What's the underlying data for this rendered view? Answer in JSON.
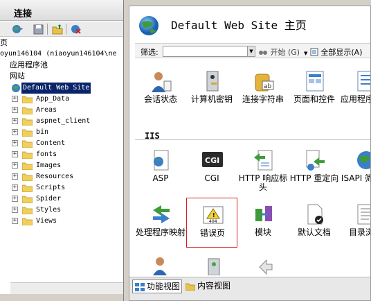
{
  "connections": {
    "title": "连接",
    "tree": [
      {
        "label": "页",
        "indent": 0
      },
      {
        "label": "oyun146104 (niaoyun146104\\ne",
        "indent": 0,
        "mono": true
      },
      {
        "label": "应用程序池",
        "indent": 0
      },
      {
        "label": "网站",
        "indent": 0
      },
      {
        "label": "Default Web Site",
        "selected": true
      },
      {
        "label": "App_Data"
      },
      {
        "label": "Areas"
      },
      {
        "label": "aspnet_client"
      },
      {
        "label": "bin"
      },
      {
        "label": "Content"
      },
      {
        "label": "fonts"
      },
      {
        "label": "Images"
      },
      {
        "label": "Resources"
      },
      {
        "label": "Scripts"
      },
      {
        "label": "Spider"
      },
      {
        "label": "Styles"
      },
      {
        "label": "Views"
      }
    ]
  },
  "home": {
    "title": "Default Web Site 主页",
    "filter": {
      "label": "筛选:",
      "start": "开始 (G)",
      "show_all": "全部显示(A)"
    },
    "group_iis": "IIS",
    "features_top": [
      {
        "name": "session-state",
        "label": "会话状态"
      },
      {
        "name": "machine-key",
        "label": "计算机密钥"
      },
      {
        "name": "connection-strings",
        "label": "连接字符串"
      },
      {
        "name": "pages-controls",
        "label": "页面和控件"
      },
      {
        "name": "app-settings",
        "label": "应用程序设置"
      }
    ],
    "features_iis_row1": [
      {
        "name": "asp",
        "label": "ASP"
      },
      {
        "name": "cgi",
        "label": "CGI"
      },
      {
        "name": "http-response-headers",
        "label": "HTTP 响应标头"
      },
      {
        "name": "http-redirect",
        "label": "HTTP 重定向"
      },
      {
        "name": "isapi-filters",
        "label": "ISAPI 筛选器"
      }
    ],
    "features_iis_row2": [
      {
        "name": "handler-mappings",
        "label": "处理程序映射"
      },
      {
        "name": "error-pages",
        "label": "错误页"
      },
      {
        "name": "modules",
        "label": "模块"
      },
      {
        "name": "default-document",
        "label": "默认文档"
      },
      {
        "name": "directory-browsing",
        "label": "目录浏览"
      }
    ],
    "tabs": {
      "features_view": "功能视图",
      "content_view": "内容视图"
    }
  },
  "colors": {
    "selection": "#0a246a",
    "highlight_border": "#d81e1e"
  }
}
